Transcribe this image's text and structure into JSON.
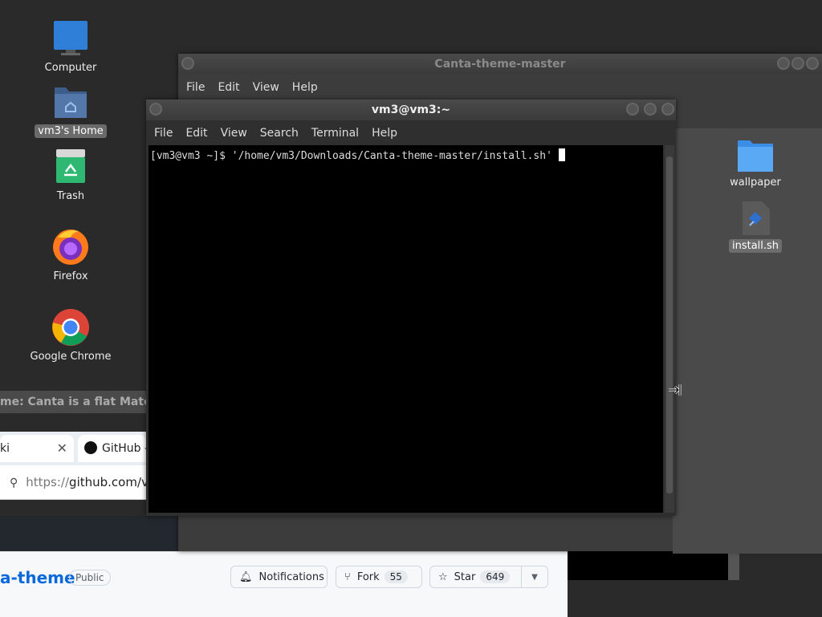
{
  "desktop": {
    "icons": [
      {
        "label": "Computer",
        "icon": "monitor-icon"
      },
      {
        "label": "vm3's Home",
        "icon": "home-folder-icon"
      },
      {
        "label": "Trash",
        "icon": "trash-icon"
      },
      {
        "label": "Firefox",
        "icon": "firefox-icon"
      },
      {
        "label": "Google Chrome",
        "icon": "chrome-icon"
      }
    ]
  },
  "file_manager": {
    "title": "Canta-theme-master",
    "menu": [
      "File",
      "Edit",
      "View",
      "Help"
    ],
    "items": [
      {
        "label": "wallpaper",
        "icon": "folder-icon"
      },
      {
        "label": "install.sh",
        "icon": "script-file-icon"
      }
    ]
  },
  "terminal": {
    "title": "vm3@vm3:~",
    "menu": [
      "File",
      "Edit",
      "View",
      "Search",
      "Terminal",
      "Help"
    ],
    "line": "[vm3@vm3 ~]$ '/home/vm3/Downloads/Canta-theme-master/install.sh'"
  },
  "browser": {
    "window_title": "me: Canta is a flat Material",
    "tab1_label": "ki",
    "tab2_label": "GitHub -",
    "url_prefix": "https://",
    "url_domain": "github.com/vi",
    "repo_name": "a-theme",
    "visibility": "Public",
    "notifications_label": "Notifications",
    "fork_label": "Fork",
    "fork_count": "55",
    "star_label": "Star",
    "star_count": "649"
  },
  "colors": {
    "accent_blue": "#2f7fd8",
    "link_blue": "#0969da"
  }
}
